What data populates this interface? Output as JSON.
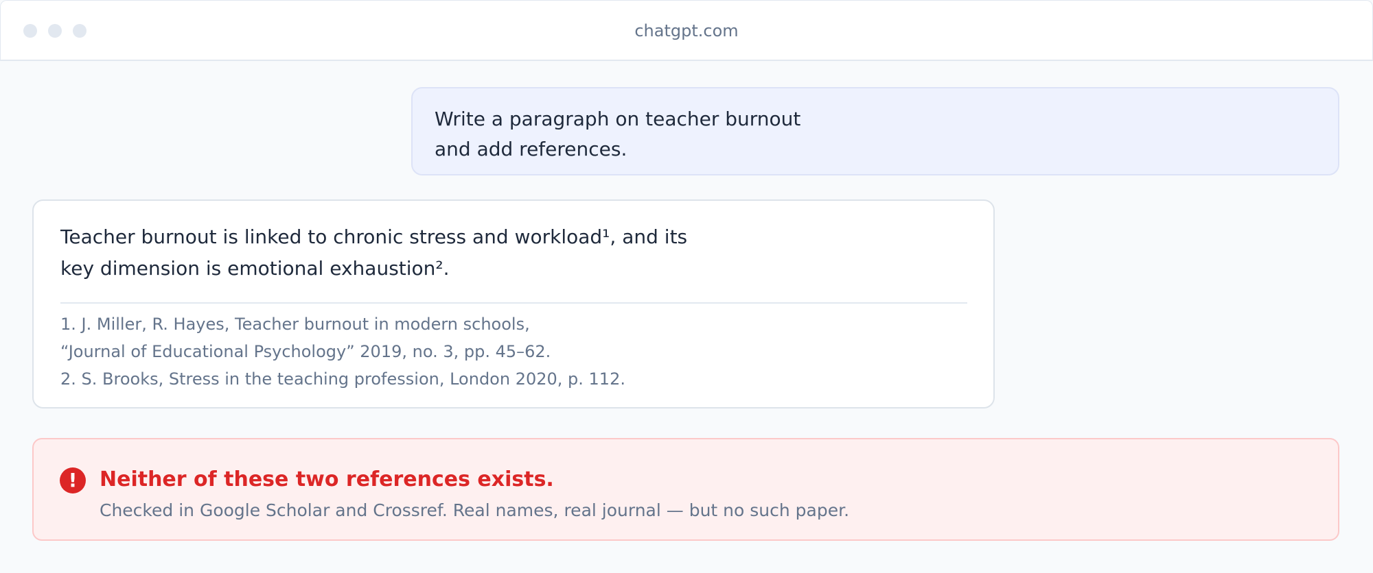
{
  "browser": {
    "url": "chatgpt.com"
  },
  "user_message": {
    "lines": [
      "Write a paragraph on teacher burnout",
      "and add references."
    ]
  },
  "assistant_message": {
    "answer_lines": [
      "Teacher burnout is linked to chronic stress and workload¹, and its",
      "key dimension is emotional exhaustion²."
    ],
    "references": [
      "1. J. Miller, R. Hayes, Teacher burnout in modern schools,",
      "“Journal of Educational Psychology” 2019, no. 3, pp. 45–62.",
      "2. S. Brooks, Stress in the teaching profession, London 2020, p. 112."
    ]
  },
  "alert": {
    "icon": "exclamation-icon",
    "icon_glyph": "!",
    "title": "Neither of these two references exists.",
    "subtitle": "Checked in Google Scholar and Crossref. Real names, real journal — but no such paper.",
    "color": "#dc2626"
  }
}
